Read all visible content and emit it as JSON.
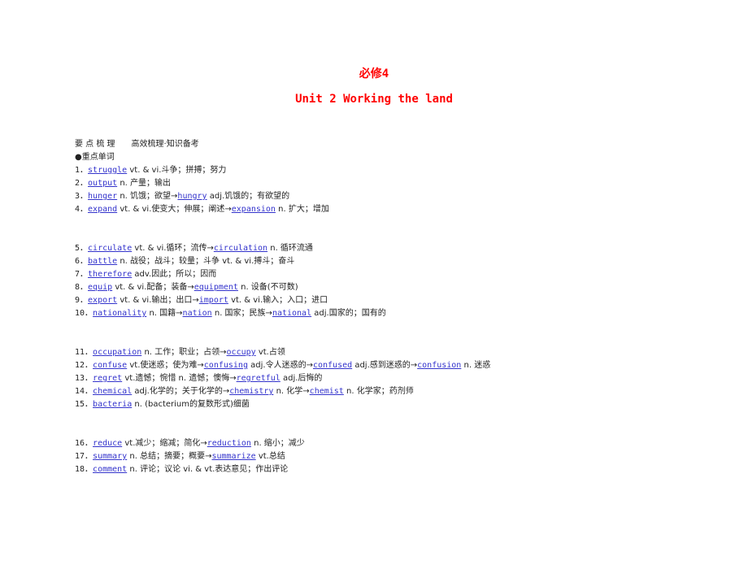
{
  "header": {
    "book": "必修4",
    "unit": "Unit 2  Working the land"
  },
  "section": {
    "label": "要 点 梳 理",
    "sublabel": "高效梳理·知识备考",
    "heading": "●重点单词"
  },
  "groups": [
    [
      {
        "num": "1．",
        "parts": [
          {
            "w": "struggle"
          },
          {
            "t": " vt. & vi.斗争；拼搏；努力"
          }
        ]
      },
      {
        "num": "2．",
        "parts": [
          {
            "w": "output"
          },
          {
            "t": " n. 产量；输出"
          }
        ]
      },
      {
        "num": "3．",
        "parts": [
          {
            "w": "hunger"
          },
          {
            "t": " n. 饥饿；欲望→"
          },
          {
            "w": "hungry"
          },
          {
            "t": " adj.饥饿的；有欲望的"
          }
        ]
      },
      {
        "num": "4．",
        "parts": [
          {
            "w": "expand"
          },
          {
            "t": " vt. & vi.使变大；伸展；阐述→"
          },
          {
            "w": "expansion"
          },
          {
            "t": " n. 扩大；增加"
          }
        ]
      }
    ],
    [
      {
        "num": "5．",
        "parts": [
          {
            "w": "circulate"
          },
          {
            "t": " vt. & vi.循环；流传→"
          },
          {
            "w": "circulation"
          },
          {
            "t": " n. 循环流通"
          }
        ]
      },
      {
        "num": "6．",
        "parts": [
          {
            "w": "battle"
          },
          {
            "t": " n. 战役；战斗；较量；斗争 vt. & vi.搏斗；奋斗"
          }
        ]
      },
      {
        "num": "7．",
        "parts": [
          {
            "w": "therefore"
          },
          {
            "t": " adv.因此；所以；因而"
          }
        ]
      },
      {
        "num": "8．",
        "parts": [
          {
            "w": "equip"
          },
          {
            "t": " vt. & vi.配备；装备→"
          },
          {
            "w": "equipment"
          },
          {
            "t": " n. 设备(不可数)"
          }
        ]
      },
      {
        "num": "9．",
        "parts": [
          {
            "w": "export"
          },
          {
            "t": " vt. & vi.输出；出口→"
          },
          {
            "w": "import"
          },
          {
            "t": " vt. & vi.输入；入口；进口"
          }
        ]
      },
      {
        "num": "10．",
        "parts": [
          {
            "w": "nationality"
          },
          {
            "t": " n. 国籍→"
          },
          {
            "w": "nation"
          },
          {
            "t": " n. 国家；民族→"
          },
          {
            "w": "national"
          },
          {
            "t": " adj.国家的；国有的"
          }
        ]
      }
    ],
    [
      {
        "num": "11．",
        "parts": [
          {
            "w": "occupation"
          },
          {
            "t": " n. 工作；职业；占领→"
          },
          {
            "w": "occupy"
          },
          {
            "t": " vt.占领"
          }
        ]
      },
      {
        "num": "12．",
        "parts": [
          {
            "w": "confuse"
          },
          {
            "t": " vt.使迷惑；使为难→"
          },
          {
            "w": "confusing"
          },
          {
            "t": " adj.令人迷惑的→"
          },
          {
            "w": "confused"
          },
          {
            "t": " adj.感到迷惑的→"
          },
          {
            "w": "confusion"
          },
          {
            "t": " n. 迷惑"
          }
        ]
      },
      {
        "num": "13．",
        "parts": [
          {
            "w": "regret"
          },
          {
            "t": " vt.遗憾；惋惜 n. 遗憾；懊悔→"
          },
          {
            "w": "regretful"
          },
          {
            "t": " adj.后悔的"
          }
        ]
      },
      {
        "num": "14．",
        "parts": [
          {
            "w": "chemical"
          },
          {
            "t": " adj.化学的；关于化学的→"
          },
          {
            "w": "chemistry"
          },
          {
            "t": " n. 化学→"
          },
          {
            "w": "chemist"
          },
          {
            "t": " n. 化学家；药剂师"
          }
        ]
      },
      {
        "num": "15．",
        "parts": [
          {
            "w": "bacteria"
          },
          {
            "t": " n. (bacterium的复数形式)细菌"
          }
        ]
      }
    ],
    [
      {
        "num": "16．",
        "parts": [
          {
            "w": "reduce"
          },
          {
            "t": " vt.减少；缩减；简化→"
          },
          {
            "w": "reduction"
          },
          {
            "t": " n. 缩小；减少"
          }
        ]
      },
      {
        "num": "17．",
        "parts": [
          {
            "w": "summary"
          },
          {
            "t": " n. 总结；摘要；概要→"
          },
          {
            "w": "summarize"
          },
          {
            "t": " vt.总结"
          }
        ]
      },
      {
        "num": "18．",
        "parts": [
          {
            "w": "comment"
          },
          {
            "t": " n. 评论；议论 vi. & vt.表达意见；作出评论"
          }
        ]
      }
    ]
  ]
}
